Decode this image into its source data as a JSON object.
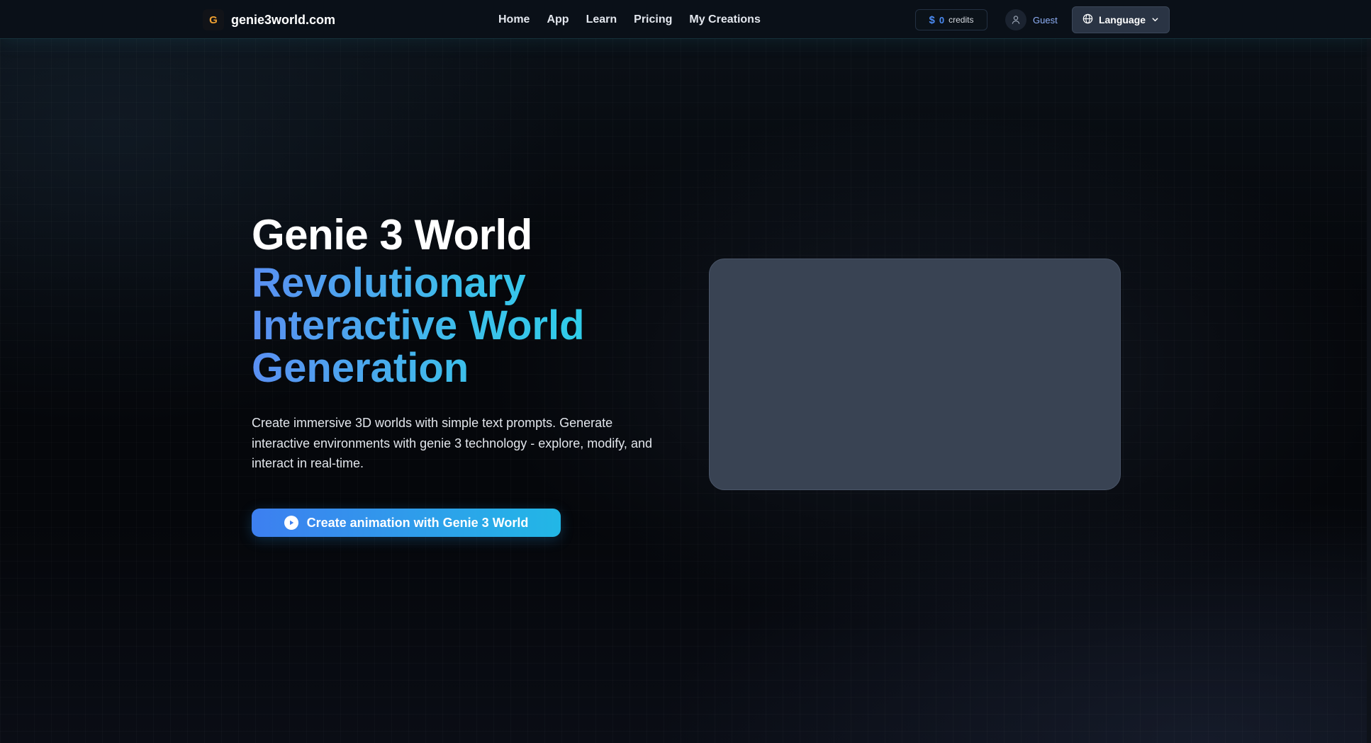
{
  "header": {
    "logo": {
      "mark": "G",
      "text": "genie3world.com",
      "mark_color": "#f0a030"
    },
    "nav": [
      {
        "label": "Home"
      },
      {
        "label": "App"
      },
      {
        "label": "Learn"
      },
      {
        "label": "Pricing"
      },
      {
        "label": "My Creations"
      }
    ],
    "credits": {
      "icon": "dollar-icon",
      "symbol": "$",
      "amount": "0",
      "label": "credits"
    },
    "user": {
      "icon": "user-icon",
      "name": "Guest"
    },
    "language": {
      "icon": "globe-icon",
      "label": "Language",
      "chevron": "chevron-down-icon"
    }
  },
  "hero": {
    "title": "Genie 3 World",
    "subtitle": "Revolutionary Interactive World Generation",
    "description": "Create immersive 3D worlds with simple text prompts. Generate interactive environments with genie 3 technology - explore, modify, and interact in real-time.",
    "cta": {
      "icon": "play-icon",
      "label": "Create animation with Genie 3 World"
    }
  },
  "colors": {
    "accent_blue": "#4c8cf5",
    "accent_cyan": "#28d3e8",
    "panel": "#394353",
    "background": "#05070b"
  }
}
